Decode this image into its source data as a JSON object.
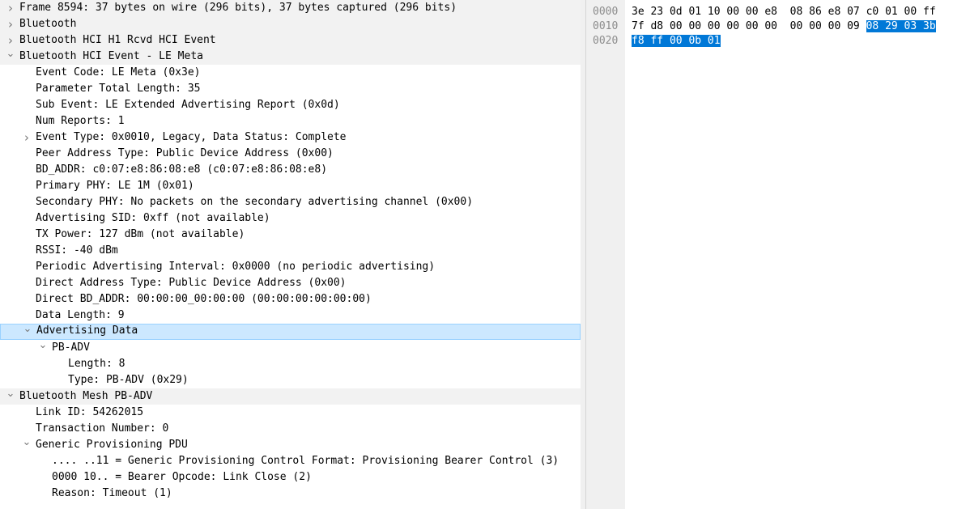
{
  "tree": [
    {
      "label": "Frame 8594: 37 bytes on wire (296 bits), 37 bytes captured (296 bits)",
      "level": 0,
      "state": "collapsed",
      "top": true
    },
    {
      "label": "Bluetooth",
      "level": 0,
      "state": "collapsed",
      "top": true
    },
    {
      "label": "Bluetooth HCI H1 Rcvd HCI Event",
      "level": 0,
      "state": "collapsed",
      "top": true
    },
    {
      "label": "Bluetooth HCI Event - LE Meta",
      "level": 0,
      "state": "expanded",
      "top": true
    },
    {
      "label": "Event Code: LE Meta (0x3e)",
      "level": 1,
      "state": "none"
    },
    {
      "label": "Parameter Total Length: 35",
      "level": 1,
      "state": "none"
    },
    {
      "label": "Sub Event: LE Extended Advertising Report (0x0d)",
      "level": 1,
      "state": "none"
    },
    {
      "label": "Num Reports: 1",
      "level": 1,
      "state": "none"
    },
    {
      "label": "Event Type: 0x0010, Legacy, Data Status: Complete",
      "level": 1,
      "state": "collapsed"
    },
    {
      "label": "Peer Address Type: Public Device Address (0x00)",
      "level": 1,
      "state": "none"
    },
    {
      "label": "BD_ADDR: c0:07:e8:86:08:e8 (c0:07:e8:86:08:e8)",
      "level": 1,
      "state": "none"
    },
    {
      "label": "Primary PHY: LE 1M (0x01)",
      "level": 1,
      "state": "none"
    },
    {
      "label": "Secondary PHY: No packets on the secondary advertising channel (0x00)",
      "level": 1,
      "state": "none"
    },
    {
      "label": "Advertising SID: 0xff (not available)",
      "level": 1,
      "state": "none"
    },
    {
      "label": "TX Power: 127 dBm (not available)",
      "level": 1,
      "state": "none"
    },
    {
      "label": "RSSI: -40 dBm",
      "level": 1,
      "state": "none"
    },
    {
      "label": "Periodic Advertising Interval: 0x0000 (no periodic advertising)",
      "level": 1,
      "state": "none"
    },
    {
      "label": "Direct Address Type: Public Device Address (0x00)",
      "level": 1,
      "state": "none"
    },
    {
      "label": "Direct BD_ADDR: 00:00:00_00:00:00 (00:00:00:00:00:00)",
      "level": 1,
      "state": "none"
    },
    {
      "label": "Data Length: 9",
      "level": 1,
      "state": "none"
    },
    {
      "label": "Advertising Data",
      "level": 1,
      "state": "expanded",
      "selected": true
    },
    {
      "label": "PB-ADV",
      "level": 2,
      "state": "expanded"
    },
    {
      "label": "Length: 8",
      "level": 3,
      "state": "none"
    },
    {
      "label": "Type: PB-ADV (0x29)",
      "level": 3,
      "state": "none"
    },
    {
      "label": "Bluetooth Mesh PB-ADV",
      "level": 0,
      "state": "expanded",
      "top": true
    },
    {
      "label": "Link ID: 54262015",
      "level": 1,
      "state": "none"
    },
    {
      "label": "Transaction Number: 0",
      "level": 1,
      "state": "none"
    },
    {
      "label": "Generic Provisioning PDU",
      "level": 1,
      "state": "expanded"
    },
    {
      "label": ".... ..11 = Generic Provisioning Control Format: Provisioning Bearer Control (3)",
      "level": 2,
      "state": "none"
    },
    {
      "label": "0000 10.. = Bearer Opcode: Link Close (2)",
      "level": 2,
      "state": "none"
    },
    {
      "label": "Reason: Timeout (1)",
      "level": 2,
      "state": "none"
    }
  ],
  "bytes": [
    {
      "offset": "0000",
      "hex": "3e 23 0d 01 10 00 00 e8  08 86 e8 07 c0 01 00 ff",
      "hl": ""
    },
    {
      "offset": "0010",
      "hex": "7f d8 00 00 00 00 00 00  00 00 00 09 ",
      "hl": "08 29 03 3b"
    },
    {
      "offset": "0020",
      "hex": "",
      "hl": "f8 ff 00 0b 01"
    }
  ],
  "icons": {
    "collapsed": "chevron-right-icon",
    "expanded": "chevron-down-icon"
  },
  "colors": {
    "selection_bg": "#cce8ff",
    "selection_border": "#99d1ff",
    "hex_highlight": "#0078d7",
    "top_level_bg": "#f2f2f2"
  }
}
